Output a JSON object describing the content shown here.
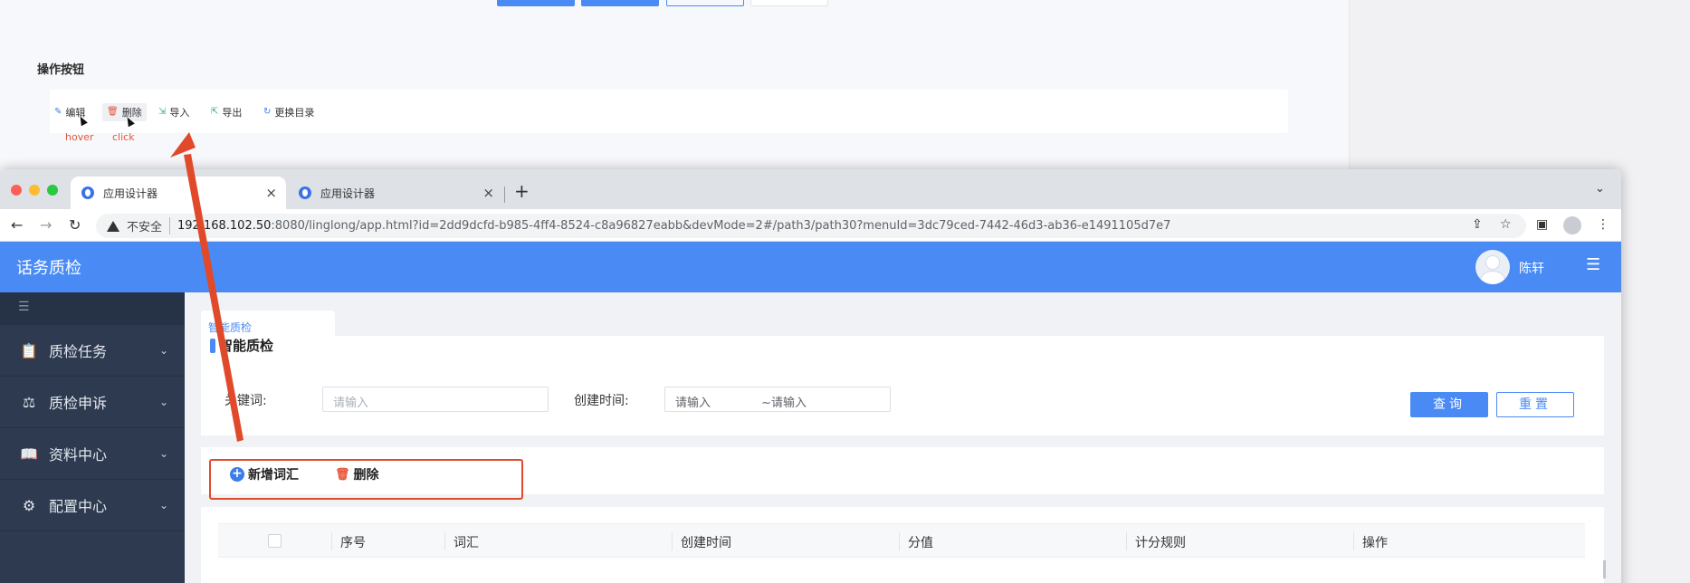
{
  "design_doc": {
    "section_title": "操作按钮",
    "buttons": [
      {
        "label": "编辑",
        "icon": "edit-icon",
        "icon_glyph": "✎"
      },
      {
        "label": "删除",
        "icon": "trash-icon",
        "icon_glyph": "🗑"
      },
      {
        "label": "导入",
        "icon": "import-icon",
        "icon_glyph": "⇲"
      },
      {
        "label": "导出",
        "icon": "export-icon",
        "icon_glyph": "⇱"
      },
      {
        "label": "更换目录",
        "icon": "refresh-icon",
        "icon_glyph": "↻"
      }
    ],
    "notes": {
      "hover": "hover",
      "click": "click"
    }
  },
  "browser": {
    "tabs": [
      {
        "title": "应用设计器",
        "active": true
      },
      {
        "title": "应用设计器",
        "active": false
      }
    ],
    "new_tab": "+",
    "address": {
      "security_label": "不安全",
      "host": "192.168.102.50",
      "rest": ":8080/linglong/app.html?id=2dd9dcfd-b985-4ff4-8524-c8a96827eabb&devMode=2#/path3/path30?menuId=3dc79ced-7442-46d3-ab36-e1491105d7e7"
    }
  },
  "app": {
    "title": "话务质检",
    "user_name": "陈轩",
    "sidebar": {
      "items": [
        {
          "label": "质检任务",
          "icon": "clipboard-icon",
          "glyph": "📋"
        },
        {
          "label": "质检申诉",
          "icon": "gavel-icon",
          "glyph": "⚖"
        },
        {
          "label": "资料中心",
          "icon": "book-icon",
          "glyph": "📖"
        },
        {
          "label": "配置中心",
          "icon": "settings-icon",
          "glyph": "⚙"
        }
      ]
    },
    "page_tab": "智能质检",
    "card_title": "智能质检",
    "search": {
      "keyword_label": "关键词:",
      "keyword_placeholder": "请输入",
      "time_label": "创建时间:",
      "time_start_placeholder": "请输入",
      "time_end_placeholder": "~请输入",
      "query_label": "查询",
      "reset_label": "重置"
    },
    "toolbar": {
      "add_label": "新增词汇",
      "delete_label": "删除"
    },
    "table": {
      "columns": [
        "序号",
        "词汇",
        "创建时间",
        "分值",
        "计分规则",
        "操作"
      ]
    }
  },
  "colors": {
    "primary": "#4a8af4",
    "sidebar_bg": "#2d3a4f",
    "annotation_red": "#e04a2b",
    "danger": "#e5553a"
  }
}
